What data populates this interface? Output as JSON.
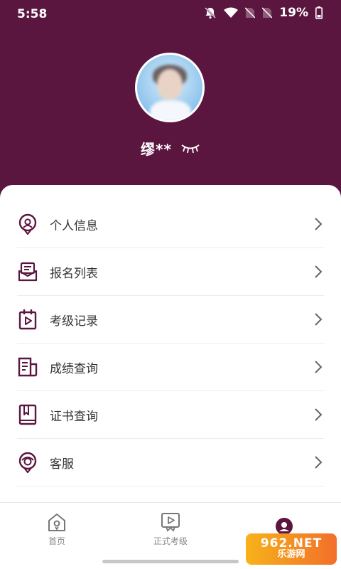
{
  "status_bar": {
    "time": "5:58",
    "battery": "19%",
    "icons": [
      "bell-muted-icon",
      "wifi-icon",
      "no-sim-icon",
      "no-sim-icon",
      "battery-icon"
    ]
  },
  "profile": {
    "username": "缪**",
    "eye_icon": "closed-eye-icon"
  },
  "menu": {
    "items": [
      {
        "label": "个人信息",
        "icon": "person-info-icon"
      },
      {
        "label": "报名列表",
        "icon": "registration-list-icon"
      },
      {
        "label": "考级记录",
        "icon": "exam-record-icon"
      },
      {
        "label": "成绩查询",
        "icon": "score-query-icon"
      },
      {
        "label": "证书查询",
        "icon": "certificate-query-icon"
      },
      {
        "label": "客服",
        "icon": "customer-service-icon"
      }
    ]
  },
  "bottom_nav": {
    "items": [
      {
        "label": "首页",
        "icon": "home-icon"
      },
      {
        "label": "正式考级",
        "icon": "exam-play-icon"
      },
      {
        "label": "",
        "icon": "profile-icon"
      }
    ]
  },
  "watermark": {
    "top": "962.NET",
    "bottom": "乐游网"
  },
  "colors": {
    "primary": "#5b1640",
    "background": "#ffffff",
    "divider": "#ececec",
    "text": "#333333",
    "muted": "#888888"
  }
}
